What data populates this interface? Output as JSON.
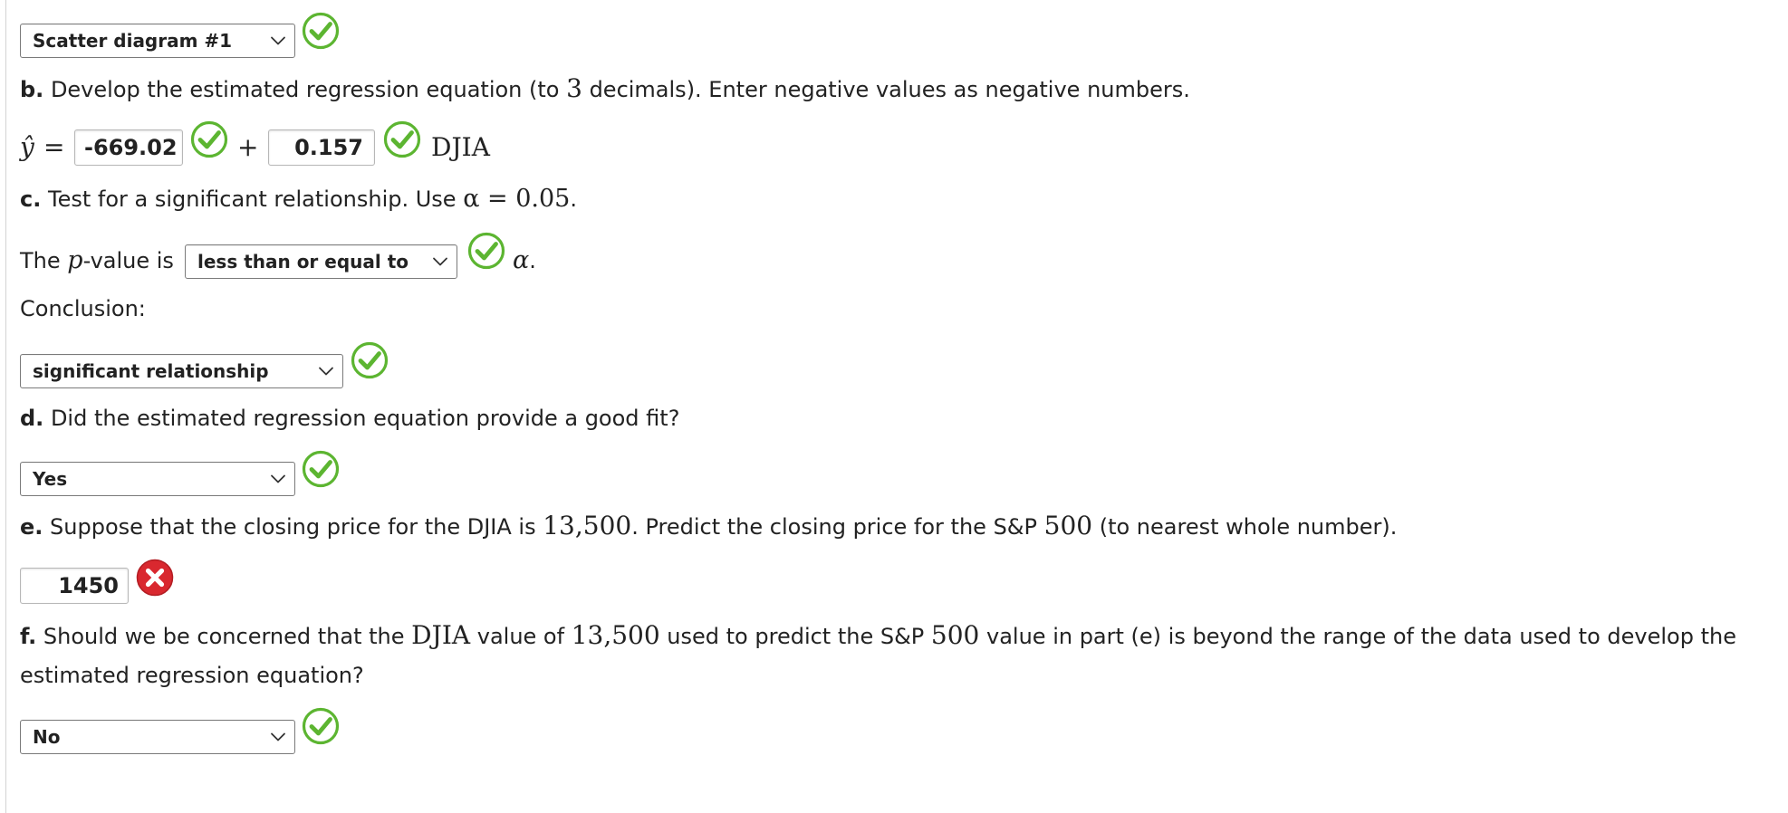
{
  "colors": {
    "correct": "#5cb531",
    "incorrect": "#d9282f"
  },
  "part_a": {
    "dropdown_value": "Scatter diagram #1",
    "status": "correct"
  },
  "part_b": {
    "label": "b.",
    "prompt_pre": "Develop the estimated regression equation (to ",
    "decimals": "3",
    "prompt_post": " decimals). Enter negative values as negative numbers.",
    "yhat": "ŷ",
    "equals": "=",
    "intercept_value": "-669.02",
    "plus": "+",
    "slope_value": "0.157",
    "variable": "DJIA",
    "intercept_status": "correct",
    "slope_status": "correct"
  },
  "part_c": {
    "label": "c.",
    "prompt_pre": "Test for a significant relationship. Use ",
    "alpha_eq": "α = 0.05",
    "prompt_post": ".",
    "pvalue_pre": "The ",
    "p_symbol": "p",
    "pvalue_mid": "-value is",
    "pvalue_dropdown": "less than or equal to",
    "pvalue_status": "correct",
    "alpha_symbol": "α",
    "alpha_post": ".",
    "conclusion_label": "Conclusion:",
    "conclusion_dropdown": "significant relationship",
    "conclusion_status": "correct"
  },
  "part_d": {
    "label": "d.",
    "prompt": "Did the estimated regression equation provide a good fit?",
    "dropdown_value": "Yes",
    "status": "correct"
  },
  "part_e": {
    "label": "e.",
    "prompt_1": "Suppose that the closing price for the DJIA is ",
    "djia_value": "13,500",
    "prompt_2": ". Predict the closing price for the S&P ",
    "sp_value": "500",
    "prompt_3": " (to nearest whole number).",
    "answer_value": "1450",
    "status": "incorrect"
  },
  "part_f": {
    "label": "f.",
    "prompt_1": "Should we be concerned that the ",
    "djia": "DJIA",
    "prompt_2": " value of ",
    "value": "13,500",
    "prompt_3": " used to predict the S&P ",
    "sp_value": "500",
    "prompt_4": " value in part (e) is beyond the range of the data used to develop the",
    "prompt_line2": "estimated regression equation?",
    "dropdown_value": "No",
    "status": "correct"
  }
}
